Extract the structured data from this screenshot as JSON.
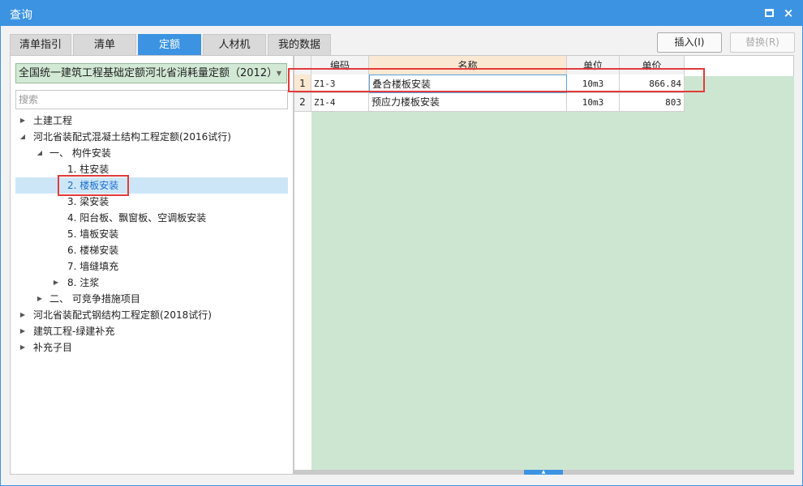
{
  "window": {
    "title": "查询",
    "maximize_icon": "maximize-icon",
    "close_icon": "close-icon",
    "close_glyph": "×"
  },
  "tabs": [
    {
      "label": "清单指引",
      "active": false
    },
    {
      "label": "清单",
      "active": false
    },
    {
      "label": "定额",
      "active": true
    },
    {
      "label": "人材机",
      "active": false
    },
    {
      "label": "我的数据",
      "active": false
    }
  ],
  "actions": {
    "insert_label": "插入(I)",
    "replace_label": "替换(R)"
  },
  "library_select": {
    "value": "全国统一建筑工程基础定额河北省消耗量定额（2012）"
  },
  "search": {
    "placeholder": "搜索"
  },
  "tree": [
    {
      "label": "土建工程",
      "level": 0,
      "expander": "collapsed"
    },
    {
      "label": "河北省装配式混凝土结构工程定额(2016试行)",
      "level": 0,
      "expander": "expanded"
    },
    {
      "label": "一、 构件安装",
      "level": 1,
      "expander": "expanded"
    },
    {
      "label": "1. 柱安装",
      "level": 2,
      "expander": "none"
    },
    {
      "label": "2. 楼板安装",
      "level": 2,
      "expander": "none",
      "selected": true
    },
    {
      "label": "3. 梁安装",
      "level": 2,
      "expander": "none"
    },
    {
      "label": "4. 阳台板、飘窗板、空调板安装",
      "level": 2,
      "expander": "none"
    },
    {
      "label": "5. 墙板安装",
      "level": 2,
      "expander": "none"
    },
    {
      "label": "6. 楼梯安装",
      "level": 2,
      "expander": "none"
    },
    {
      "label": "7. 墙缝填充",
      "level": 2,
      "expander": "none"
    },
    {
      "label": "8. 注浆",
      "level": 2,
      "expander": "collapsed"
    },
    {
      "label": "二、 可竞争措施项目",
      "level": 1,
      "expander": "collapsed"
    },
    {
      "label": "河北省装配式钢结构工程定额(2018试行)",
      "level": 0,
      "expander": "collapsed"
    },
    {
      "label": "建筑工程-绿建补充",
      "level": 0,
      "expander": "collapsed"
    },
    {
      "label": "补充子目",
      "level": 0,
      "expander": "collapsed"
    }
  ],
  "grid": {
    "headers": [
      "编码",
      "名称",
      "单位",
      "单价"
    ],
    "rows": [
      {
        "num": "1",
        "code": "Z1-3",
        "name": "叠合楼板安装",
        "unit": "10m3",
        "price": "866.84",
        "current": true
      },
      {
        "num": "2",
        "code": "Z1-4",
        "name": "预应力楼板安装",
        "unit": "10m3",
        "price": "803",
        "current": false
      }
    ]
  },
  "colors": {
    "accent": "#3b93e2",
    "grid_bg": "#cde6d1",
    "highlight_box": "#e23b3b",
    "selected_row": "#cde6f7"
  }
}
